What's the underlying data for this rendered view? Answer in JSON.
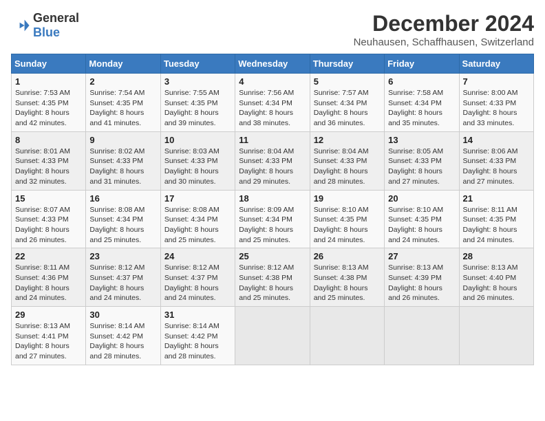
{
  "header": {
    "logo_general": "General",
    "logo_blue": "Blue",
    "main_title": "December 2024",
    "subtitle": "Neuhausen, Schaffhausen, Switzerland"
  },
  "weekdays": [
    "Sunday",
    "Monday",
    "Tuesday",
    "Wednesday",
    "Thursday",
    "Friday",
    "Saturday"
  ],
  "weeks": [
    [
      {
        "day": "1",
        "sunrise": "7:53 AM",
        "sunset": "4:35 PM",
        "daylight": "8 hours and 42 minutes."
      },
      {
        "day": "2",
        "sunrise": "7:54 AM",
        "sunset": "4:35 PM",
        "daylight": "8 hours and 41 minutes."
      },
      {
        "day": "3",
        "sunrise": "7:55 AM",
        "sunset": "4:35 PM",
        "daylight": "8 hours and 39 minutes."
      },
      {
        "day": "4",
        "sunrise": "7:56 AM",
        "sunset": "4:34 PM",
        "daylight": "8 hours and 38 minutes."
      },
      {
        "day": "5",
        "sunrise": "7:57 AM",
        "sunset": "4:34 PM",
        "daylight": "8 hours and 36 minutes."
      },
      {
        "day": "6",
        "sunrise": "7:58 AM",
        "sunset": "4:34 PM",
        "daylight": "8 hours and 35 minutes."
      },
      {
        "day": "7",
        "sunrise": "8:00 AM",
        "sunset": "4:33 PM",
        "daylight": "8 hours and 33 minutes."
      }
    ],
    [
      {
        "day": "8",
        "sunrise": "8:01 AM",
        "sunset": "4:33 PM",
        "daylight": "8 hours and 32 minutes."
      },
      {
        "day": "9",
        "sunrise": "8:02 AM",
        "sunset": "4:33 PM",
        "daylight": "8 hours and 31 minutes."
      },
      {
        "day": "10",
        "sunrise": "8:03 AM",
        "sunset": "4:33 PM",
        "daylight": "8 hours and 30 minutes."
      },
      {
        "day": "11",
        "sunrise": "8:04 AM",
        "sunset": "4:33 PM",
        "daylight": "8 hours and 29 minutes."
      },
      {
        "day": "12",
        "sunrise": "8:04 AM",
        "sunset": "4:33 PM",
        "daylight": "8 hours and 28 minutes."
      },
      {
        "day": "13",
        "sunrise": "8:05 AM",
        "sunset": "4:33 PM",
        "daylight": "8 hours and 27 minutes."
      },
      {
        "day": "14",
        "sunrise": "8:06 AM",
        "sunset": "4:33 PM",
        "daylight": "8 hours and 27 minutes."
      }
    ],
    [
      {
        "day": "15",
        "sunrise": "8:07 AM",
        "sunset": "4:33 PM",
        "daylight": "8 hours and 26 minutes."
      },
      {
        "day": "16",
        "sunrise": "8:08 AM",
        "sunset": "4:34 PM",
        "daylight": "8 hours and 25 minutes."
      },
      {
        "day": "17",
        "sunrise": "8:08 AM",
        "sunset": "4:34 PM",
        "daylight": "8 hours and 25 minutes."
      },
      {
        "day": "18",
        "sunrise": "8:09 AM",
        "sunset": "4:34 PM",
        "daylight": "8 hours and 25 minutes."
      },
      {
        "day": "19",
        "sunrise": "8:10 AM",
        "sunset": "4:35 PM",
        "daylight": "8 hours and 24 minutes."
      },
      {
        "day": "20",
        "sunrise": "8:10 AM",
        "sunset": "4:35 PM",
        "daylight": "8 hours and 24 minutes."
      },
      {
        "day": "21",
        "sunrise": "8:11 AM",
        "sunset": "4:35 PM",
        "daylight": "8 hours and 24 minutes."
      }
    ],
    [
      {
        "day": "22",
        "sunrise": "8:11 AM",
        "sunset": "4:36 PM",
        "daylight": "8 hours and 24 minutes."
      },
      {
        "day": "23",
        "sunrise": "8:12 AM",
        "sunset": "4:37 PM",
        "daylight": "8 hours and 24 minutes."
      },
      {
        "day": "24",
        "sunrise": "8:12 AM",
        "sunset": "4:37 PM",
        "daylight": "8 hours and 24 minutes."
      },
      {
        "day": "25",
        "sunrise": "8:12 AM",
        "sunset": "4:38 PM",
        "daylight": "8 hours and 25 minutes."
      },
      {
        "day": "26",
        "sunrise": "8:13 AM",
        "sunset": "4:38 PM",
        "daylight": "8 hours and 25 minutes."
      },
      {
        "day": "27",
        "sunrise": "8:13 AM",
        "sunset": "4:39 PM",
        "daylight": "8 hours and 26 minutes."
      },
      {
        "day": "28",
        "sunrise": "8:13 AM",
        "sunset": "4:40 PM",
        "daylight": "8 hours and 26 minutes."
      }
    ],
    [
      {
        "day": "29",
        "sunrise": "8:13 AM",
        "sunset": "4:41 PM",
        "daylight": "8 hours and 27 minutes."
      },
      {
        "day": "30",
        "sunrise": "8:14 AM",
        "sunset": "4:42 PM",
        "daylight": "8 hours and 28 minutes."
      },
      {
        "day": "31",
        "sunrise": "8:14 AM",
        "sunset": "4:42 PM",
        "daylight": "8 hours and 28 minutes."
      },
      null,
      null,
      null,
      null
    ]
  ],
  "labels": {
    "sunrise": "Sunrise:",
    "sunset": "Sunset:",
    "daylight": "Daylight:"
  }
}
